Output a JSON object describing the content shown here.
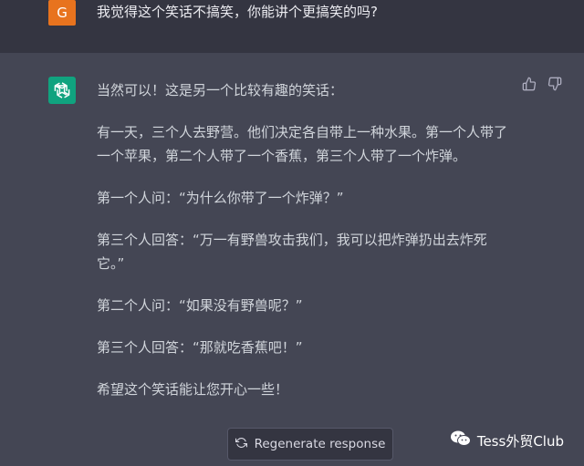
{
  "user": {
    "avatar_letter": "G",
    "message": "我觉得这个笑话不搞笑，你能讲个更搞笑的吗?"
  },
  "assistant": {
    "paragraphs": [
      "当然可以！这是另一个比较有趣的笑话：",
      "有一天，三个人去野营。他们决定各自带上一种水果。第一个人带了一个苹果，第二个人带了一个香蕉，第三个人带了一个炸弹。",
      "第一个人问：“为什么你带了一个炸弹？”",
      "第三个人回答：“万一有野兽攻击我们，我可以把炸弹扔出去炸死它。”",
      "第二个人问：“如果没有野兽呢？”",
      "第三个人回答：“那就吃香蕉吧！”",
      "希望这个笑话能让您开心一些！"
    ]
  },
  "regenerate_label": "Regenerate response",
  "watermark_text": "Tess外贸Club",
  "colors": {
    "user_bg": "#343541",
    "assistant_bg": "#444654",
    "user_avatar": "#e8731e",
    "bot_avatar": "#10a37f"
  }
}
